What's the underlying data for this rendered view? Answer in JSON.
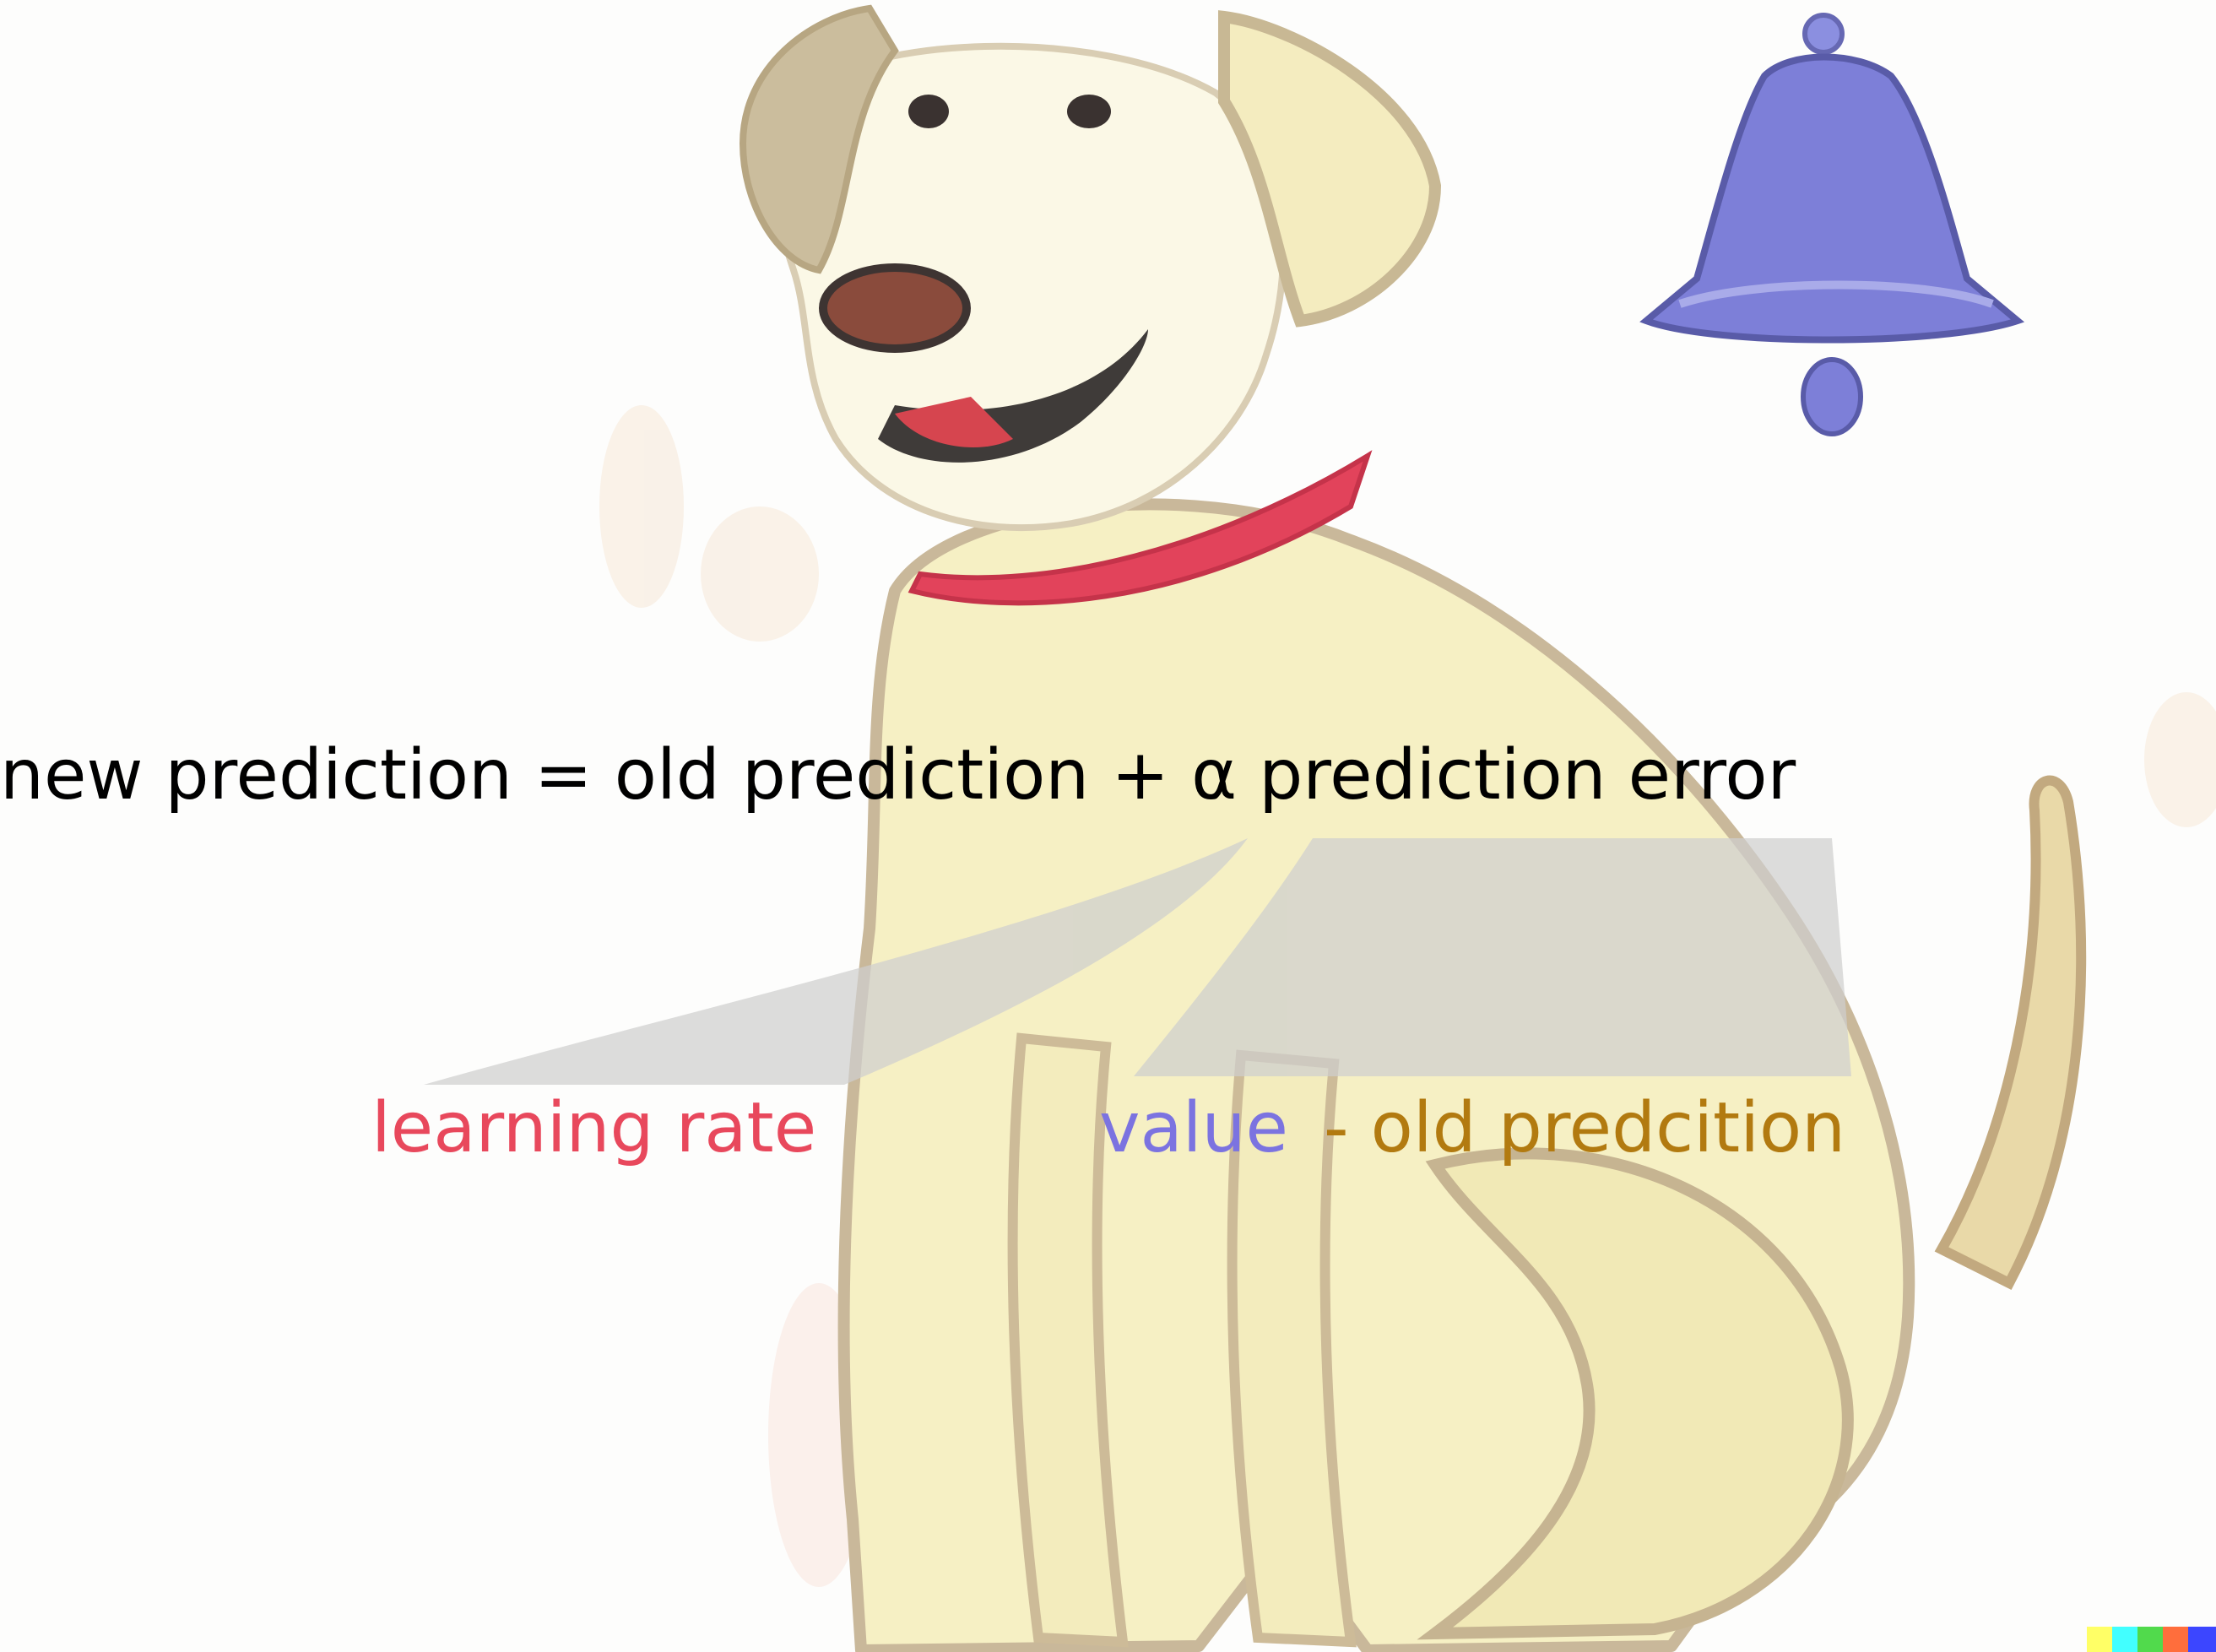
{
  "equation": {
    "text": "new prediction = old prediction + α prediction error",
    "color": "#000000"
  },
  "labels": {
    "learning_rate": {
      "text": "learning rate",
      "color": "#e8485c"
    },
    "value": {
      "text": "value",
      "color": "#7b73e0"
    },
    "minus_old_prediction": {
      "text": "- old predcition",
      "color": "#b27a10"
    }
  },
  "illustration": {
    "icons": [
      "dog-illustration",
      "bell-icon"
    ],
    "colors": {
      "dog_fur": "#f6f0c4",
      "dog_outline": "#c9b89a",
      "dog_shadow": "#d7c8a8",
      "collar": "#e2435b",
      "bell": "#7d7fd8",
      "callout": "#cfcfcf"
    }
  }
}
